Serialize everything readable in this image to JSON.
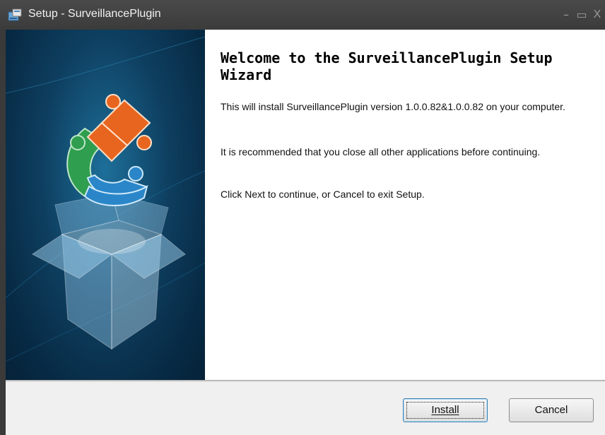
{
  "window": {
    "title": "Setup - SurveillancePlugin",
    "controls": {
      "minimize": "–",
      "maximize": "▭",
      "close": "X"
    }
  },
  "welcome": {
    "heading": "Welcome to the SurveillancePlugin Setup Wizard",
    "paragraphs": [
      "This will install SurveillancePlugin version 1.0.0.82&1.0.0.82 on your computer.",
      "It is recommended that you close all other applications before continuing.",
      "Click Next to continue, or Cancel to exit Setup."
    ]
  },
  "buttons": {
    "install": "Install",
    "cancel": "Cancel"
  },
  "icons": {
    "title": "installer-icon",
    "sidebar": "puzzle-box-illustration"
  },
  "colors": {
    "accent": "#3c7fb1",
    "sidebar": "#0e3f60",
    "puzzle_orange": "#e8651f",
    "puzzle_green": "#2f9e4f",
    "puzzle_blue": "#2a86c8"
  }
}
